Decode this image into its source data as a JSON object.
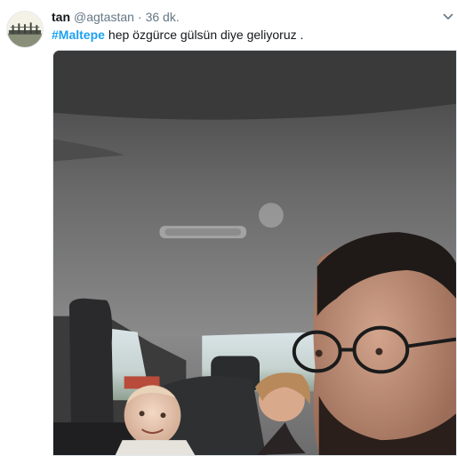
{
  "tweet": {
    "user": {
      "fullname": "tan",
      "handle": "@agtastan",
      "avatar_icon": "avatar-photo"
    },
    "separator": "·",
    "timestamp": "36 dk.",
    "hashtag": "#Maltepe",
    "text": "hep özgürce gülsün diye geliyoruz .",
    "caret_icon": "chevron-down-icon",
    "media": {
      "kind": "photo",
      "subject": "selfie-in-car"
    }
  },
  "colors": {
    "link": "#1da1f2",
    "primary_text": "#14171a",
    "secondary_text": "#657786",
    "border": "#e1e8ed"
  }
}
